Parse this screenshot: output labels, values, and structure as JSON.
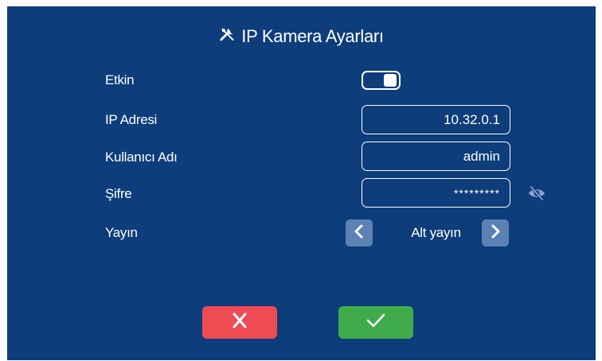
{
  "header": {
    "title": "IP Kamera Ayarları",
    "icon": "tools-icon"
  },
  "form": {
    "enabled": {
      "label": "Etkin",
      "state": "on"
    },
    "ip_address": {
      "label": "IP Adresi",
      "value": "10.32.0.1"
    },
    "username": {
      "label": "Kullanıcı Adı",
      "value": "admin"
    },
    "password": {
      "label": "Şifre",
      "value": "*********",
      "toggle_icon": "eye-slash-icon"
    },
    "stream": {
      "label": "Yayın",
      "value": "Alt yayın",
      "prev_icon": "chevron-left-icon",
      "next_icon": "chevron-right-icon"
    }
  },
  "actions": {
    "cancel_icon": "close-icon",
    "confirm_icon": "check-icon"
  },
  "colors": {
    "background": "#0d3d7a",
    "text": "#ffffff",
    "arrow_button": "#5b82b2",
    "cancel": "#ee4b55",
    "confirm": "#3fab4a"
  }
}
